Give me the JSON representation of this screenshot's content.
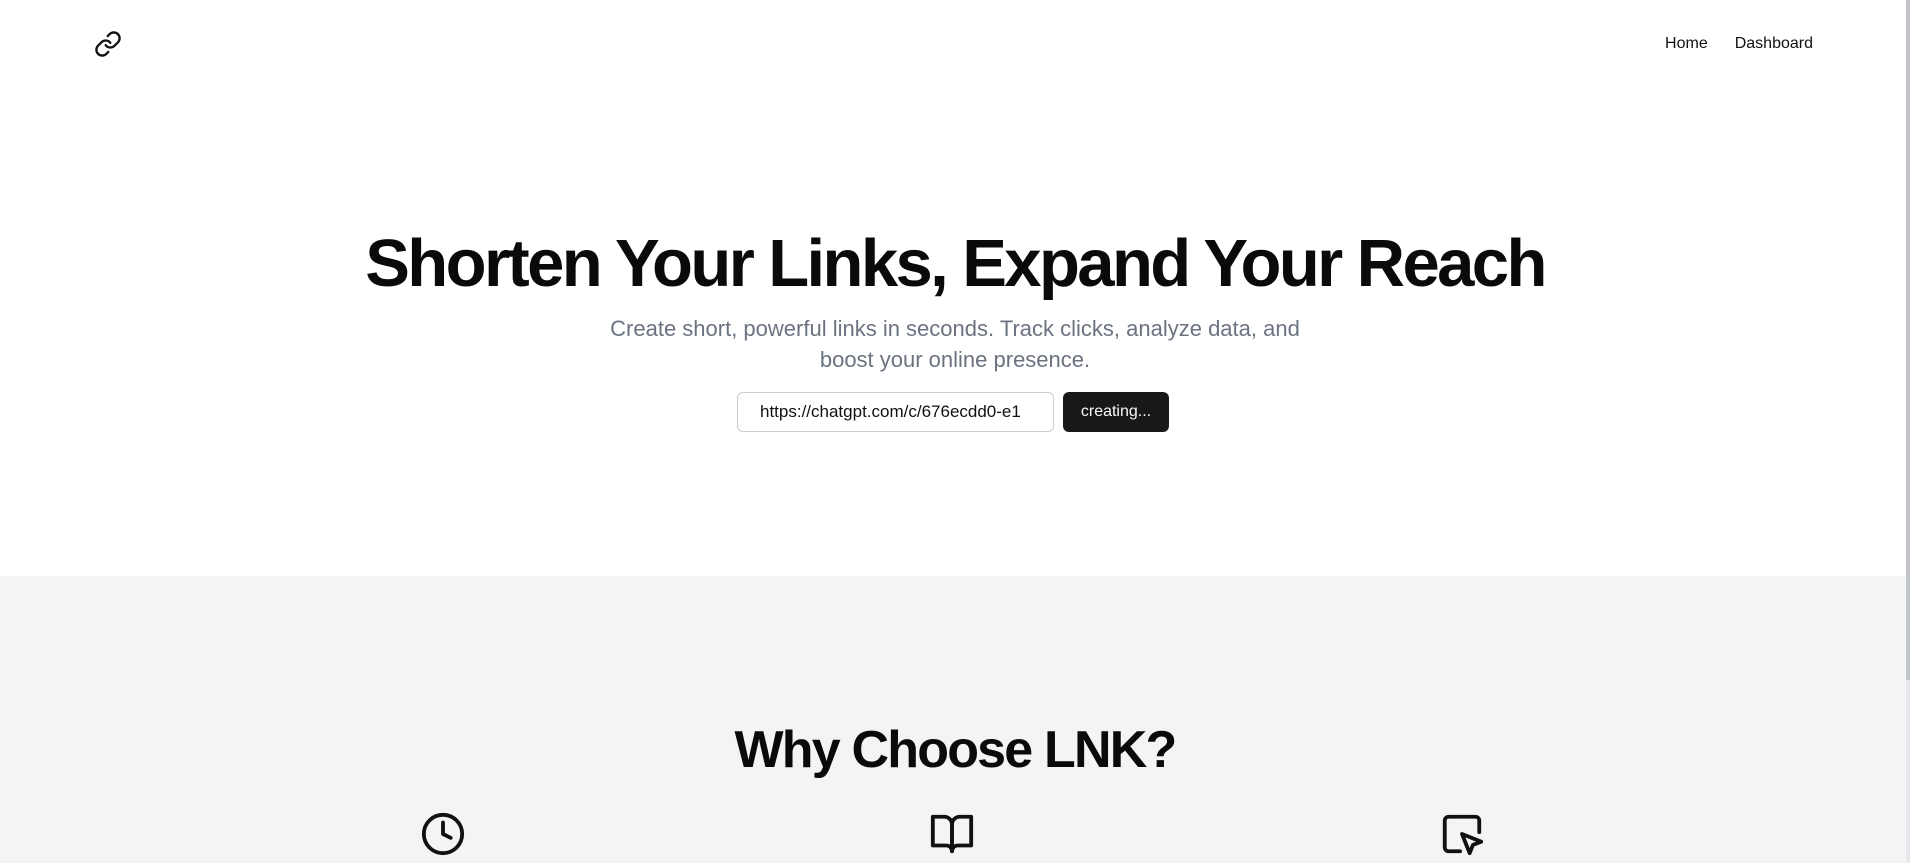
{
  "header": {
    "logo_icon": "link-icon",
    "nav": {
      "home_label": "Home",
      "dashboard_label": "Dashboard"
    }
  },
  "hero": {
    "title": "Shorten Your Links, Expand Your Reach",
    "subtitle": "Create short, powerful links in seconds. Track clicks, analyze data, and boost your online presence.",
    "input": {
      "value": "https://chatgpt.com/c/676ecdd0-e1",
      "placeholder": ""
    },
    "button_label": "creating..."
  },
  "features": {
    "title": "Why Choose LNK?",
    "icons": [
      "clock-icon",
      "book-open-icon",
      "square-mouse-pointer-icon"
    ]
  },
  "colors": {
    "primary_button": "#18181b",
    "features_background": "#f3f4f6",
    "subtitle_text": "#6b7280"
  }
}
